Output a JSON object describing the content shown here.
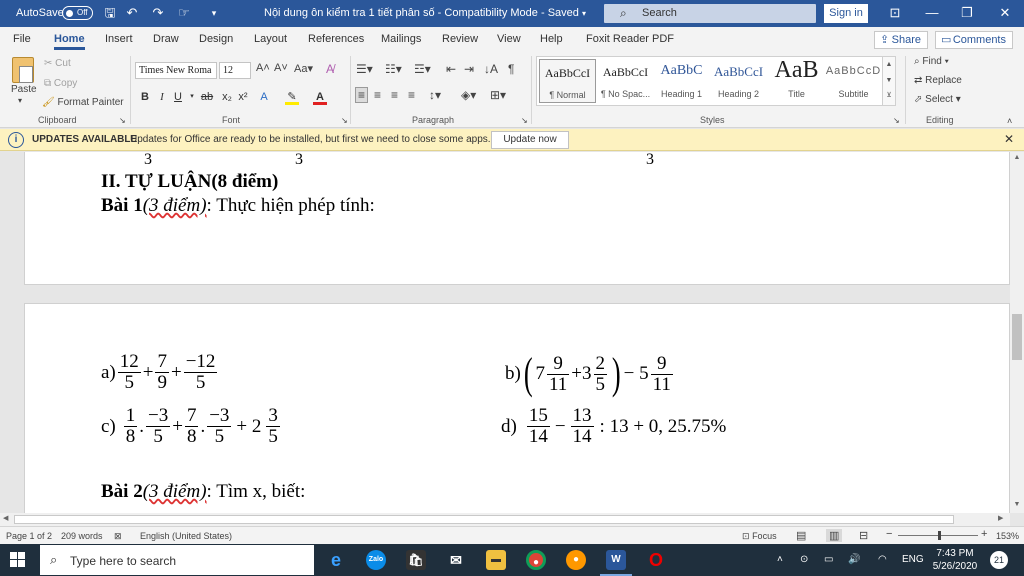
{
  "titlebar": {
    "autosave_label": "AutoSave",
    "autosave_state": "Off",
    "doc_title": "Nội dung ôn kiểm tra 1 tiết phân số  -  Compatibility Mode  -  Saved",
    "search_placeholder": "Search",
    "signin": "Sign in"
  },
  "menu": {
    "tabs": [
      "File",
      "Home",
      "Insert",
      "Draw",
      "Design",
      "Layout",
      "References",
      "Mailings",
      "Review",
      "View",
      "Help",
      "Foxit Reader PDF"
    ],
    "active": "Home",
    "share": "Share",
    "comments": "Comments"
  },
  "ribbon": {
    "clipboard": {
      "paste": "Paste",
      "cut": "Cut",
      "copy": "Copy",
      "format_painter": "Format Painter",
      "label": "Clipboard"
    },
    "font": {
      "name": "Times New Roma",
      "size": "12",
      "label": "Font"
    },
    "paragraph": {
      "label": "Paragraph"
    },
    "styles": {
      "label": "Styles",
      "items": [
        {
          "sample": "AaBbCcI",
          "name": "¶ Normal"
        },
        {
          "sample": "AaBbCcI",
          "name": "¶ No Spac..."
        },
        {
          "sample": "AaBbC",
          "name": "Heading 1"
        },
        {
          "sample": "AaBbCcI",
          "name": "Heading 2"
        },
        {
          "sample": "AaB",
          "name": "Title"
        },
        {
          "sample": "AaBbCcD",
          "name": "Subtitle"
        }
      ]
    },
    "editing": {
      "label": "Editing",
      "find": "Find",
      "replace": "Replace",
      "select": "Select"
    }
  },
  "notice": {
    "header": "UPDATES AVAILABLE",
    "message": "Updates for Office are ready to be installed, but first we need to close some apps.",
    "button": "Update now"
  },
  "document": {
    "top_digits": [
      "3",
      "3",
      "3"
    ],
    "section_heading": "II. TỰ LUẬN(8 điểm)",
    "bai1_prefix": "Bài 1",
    "bai1_points": "(3  điểm)",
    "bai1_text": ": Thực hiện phép tính:",
    "bai2_prefix": "Bài 2",
    "bai2_points": "(3  điểm)",
    "bai2_text": ": Tìm x, biết:",
    "problems": {
      "a": {
        "label": "a)",
        "terms": [
          [
            "12",
            "5"
          ],
          [
            "7",
            "9"
          ],
          [
            "−12",
            "5"
          ]
        ],
        "ops": [
          "+",
          "+"
        ]
      },
      "b": {
        "label": "b)",
        "w1": "7",
        "f1": [
          "9",
          "11"
        ],
        "plus": "+",
        "w2": "3",
        "f2": [
          "2",
          "5"
        ],
        "minus": "− 5",
        "f3": [
          "9",
          "11"
        ]
      },
      "c": {
        "label": "c)",
        "f1": [
          "1",
          "8"
        ],
        "f2": [
          "−3",
          "5"
        ],
        "f3": [
          "7",
          "8"
        ],
        "f4": [
          "−3",
          "5"
        ],
        "tail": "+ 2",
        "f5": [
          "3",
          "5"
        ],
        "dot": ".",
        "plus": "+"
      },
      "d": {
        "label": "d)",
        "f1": [
          "15",
          "14"
        ],
        "minus": "−",
        "f2": [
          "13",
          "14"
        ],
        "tail": ": 13 + 0, 25.75%"
      }
    }
  },
  "statusbar": {
    "page": "Page 1 of 2",
    "words": "209 words",
    "language": "English (United States)",
    "focus": "Focus",
    "zoom": "153%"
  },
  "taskbar": {
    "search_placeholder": "Type here to search",
    "lang": "ENG",
    "time": "7:43 PM",
    "date": "5/26/2020",
    "notifications": "21",
    "zalo": "Zalo"
  }
}
